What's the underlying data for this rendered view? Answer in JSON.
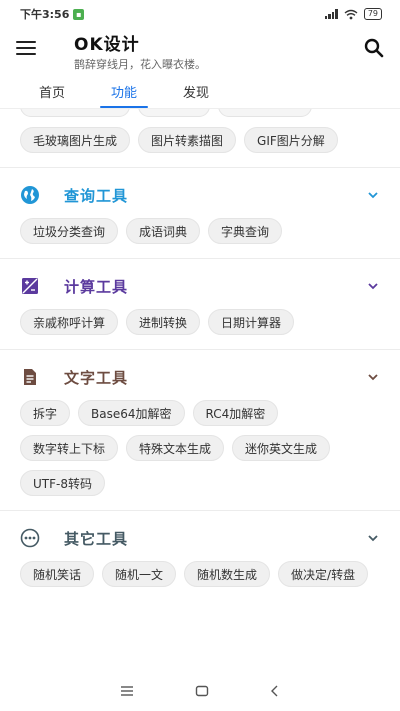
{
  "status": {
    "time": "下午3:56",
    "battery": "79"
  },
  "header": {
    "title": "OK设计",
    "subtitle": "鹊辞穿线月，花入曝衣楼。"
  },
  "tabs": [
    {
      "label": "首页",
      "active": false
    },
    {
      "label": "功能",
      "active": true
    },
    {
      "label": "发现",
      "active": false
    }
  ],
  "top_section": {
    "items": [
      "毛玻璃图片生成",
      "图片转素描图",
      "GIF图片分解"
    ]
  },
  "sections": [
    {
      "title": "查询工具",
      "color": "#2196d6",
      "icon": "globe-icon",
      "items": [
        "垃圾分类查询",
        "成语词典",
        "字典查询"
      ]
    },
    {
      "title": "计算工具",
      "color": "#5b3a9e",
      "icon": "calculator-icon",
      "items": [
        "亲戚称呼计算",
        "进制转换",
        "日期计算器"
      ]
    },
    {
      "title": "文字工具",
      "color": "#6d4c41",
      "icon": "text-document-icon",
      "items": [
        "拆字",
        "Base64加解密",
        "RC4加解密",
        "数字转上下标",
        "特殊文本生成",
        "迷你英文生成",
        "UTF-8转码"
      ]
    },
    {
      "title": "其它工具",
      "color": "#455a64",
      "icon": "more-dots-icon",
      "items": [
        "随机笑话",
        "随机一文",
        "随机数生成",
        "做决定/转盘"
      ]
    }
  ]
}
